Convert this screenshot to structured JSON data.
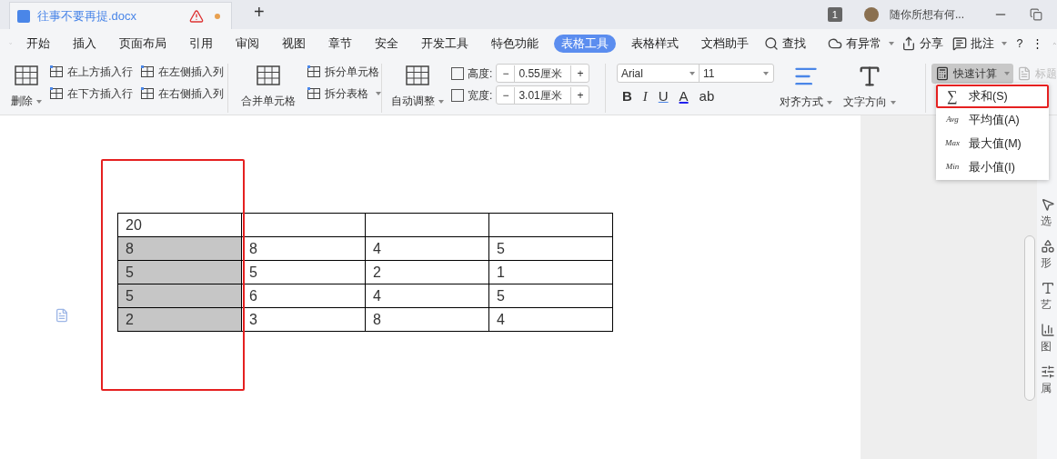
{
  "title_bar": {
    "doc_tab": {
      "title": "往事不要再提.docx",
      "unsaved": true
    },
    "new_tab": "+",
    "page_badge": "1",
    "user": "随你所想有何..."
  },
  "menu_tabs": [
    {
      "label": "开始",
      "selected": false
    },
    {
      "label": "插入",
      "selected": false
    },
    {
      "label": "页面布局",
      "selected": false
    },
    {
      "label": "引用",
      "selected": false
    },
    {
      "label": "审阅",
      "selected": false
    },
    {
      "label": "视图",
      "selected": false
    },
    {
      "label": "章节",
      "selected": false
    },
    {
      "label": "安全",
      "selected": false
    },
    {
      "label": "开发工具",
      "selected": false
    },
    {
      "label": "特色功能",
      "selected": false
    },
    {
      "label": "表格工具",
      "selected": true
    },
    {
      "label": "表格样式",
      "selected": false
    },
    {
      "label": "文档助手",
      "selected": false
    }
  ],
  "menu_right": [
    {
      "kind": "search",
      "label": "查找"
    },
    {
      "kind": "cloud",
      "label": "有异常"
    },
    {
      "kind": "share",
      "label": "分享"
    },
    {
      "kind": "comment",
      "label": "批注"
    },
    {
      "kind": "help",
      "label": "?"
    },
    {
      "kind": "more",
      "label": "⋮"
    }
  ],
  "ribbon": {
    "delete": "删除",
    "insert_row_above": "在上方插入行",
    "insert_row_below": "在下方插入行",
    "insert_col_left": "在左侧插入列",
    "insert_col_right": "在右侧插入列",
    "merge_cells": "合并单元格",
    "split_cells": "拆分单元格",
    "split_table": "拆分表格",
    "auto_fit": "自动调整",
    "height": {
      "label": "高度:",
      "value": "0.55厘米",
      "minus": "−",
      "plus": "+"
    },
    "width": {
      "label": "宽度:",
      "value": "3.01厘米",
      "minus": "−",
      "plus": "+"
    },
    "font": {
      "family": "Arial",
      "size": "11"
    },
    "format_buttons": [
      {
        "kind": "bold",
        "label": "B"
      },
      {
        "kind": "italic",
        "label": "I"
      },
      {
        "kind": "underline",
        "label": "U"
      },
      {
        "kind": "color",
        "label": "A"
      },
      {
        "kind": "highlight",
        "label": "ab"
      }
    ],
    "align": "对齐方式",
    "text_direction": "文字方向",
    "quick_calc": {
      "label": "快速计算",
      "open": true
    },
    "repeat_title": {
      "label": "标题",
      "disabled": true
    }
  },
  "quick_calc_menu": [
    {
      "icon_text": "∑",
      "label": "求和(S)",
      "highlighted": true
    },
    {
      "icon_text": "Avg",
      "label": "平均值(A)",
      "highlighted": false
    },
    {
      "icon_text": "Max",
      "label": "最大值(M)",
      "highlighted": false
    },
    {
      "icon_text": "Min",
      "label": "最小值(I)",
      "highlighted": false
    }
  ],
  "table": {
    "rows": [
      {
        "cells": [
          {
            "text": "20",
            "selected": false
          },
          {
            "text": "",
            "selected": false
          },
          {
            "text": "",
            "selected": false
          },
          {
            "text": "",
            "selected": false
          }
        ]
      },
      {
        "cells": [
          {
            "text": "8",
            "selected": true
          },
          {
            "text": "8",
            "selected": false
          },
          {
            "text": "4",
            "selected": false
          },
          {
            "text": "5",
            "selected": false
          }
        ]
      },
      {
        "cells": [
          {
            "text": "5",
            "selected": true
          },
          {
            "text": "5",
            "selected": false
          },
          {
            "text": "2",
            "selected": false
          },
          {
            "text": "1",
            "selected": false
          }
        ]
      },
      {
        "cells": [
          {
            "text": "5",
            "selected": true
          },
          {
            "text": "6",
            "selected": false
          },
          {
            "text": "4",
            "selected": false
          },
          {
            "text": "5",
            "selected": false
          }
        ]
      },
      {
        "cells": [
          {
            "text": "2",
            "selected": true
          },
          {
            "text": "3",
            "selected": false
          },
          {
            "text": "8",
            "selected": false
          },
          {
            "text": "4",
            "selected": false
          }
        ]
      }
    ]
  },
  "side_panel": [
    "选",
    "形",
    "艺",
    "图",
    "属"
  ]
}
